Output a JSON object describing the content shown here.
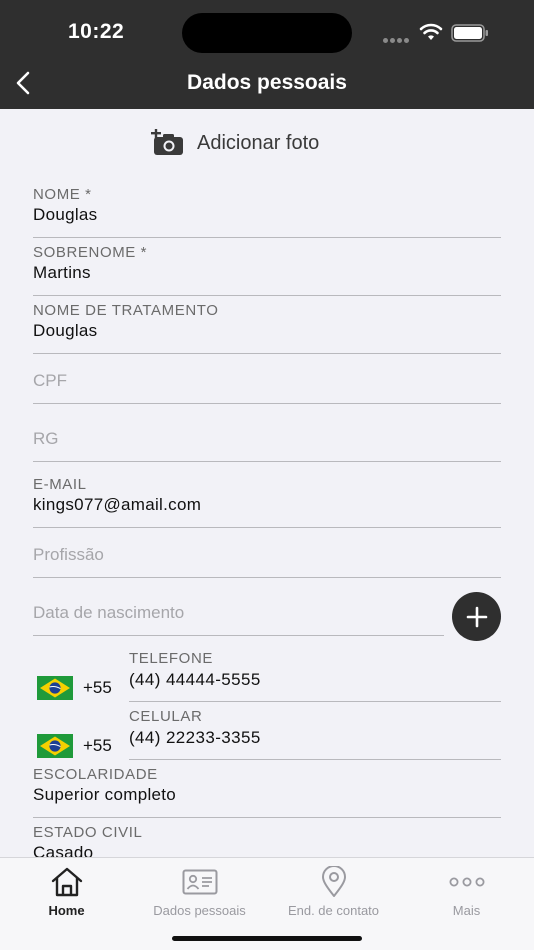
{
  "status": {
    "time": "10:22"
  },
  "header": {
    "title": "Dados pessoais"
  },
  "add_photo": {
    "label": "Adicionar foto"
  },
  "fields": {
    "nome": {
      "label": "NOME *",
      "value": "Douglas"
    },
    "sobrenome": {
      "label": "SOBRENOME *",
      "value": "Martins"
    },
    "tratamento": {
      "label": "NOME DE TRATAMENTO",
      "value": "Douglas"
    },
    "cpf": {
      "placeholder": "CPF"
    },
    "rg": {
      "placeholder": "RG"
    },
    "email": {
      "label": "E-MAIL",
      "value": "kings077@amail.com"
    },
    "profissao": {
      "placeholder": "Profissão"
    },
    "nascimento": {
      "placeholder": "Data de nascimento"
    },
    "escolaridade": {
      "label": "ESCOLARIDADE",
      "value": "Superior completo"
    },
    "estado_civil": {
      "label": "ESTADO CIVIL",
      "value": "Casado"
    }
  },
  "phones": {
    "telefone": {
      "label": "TELEFONE",
      "dial": "+55",
      "value": "(44) 44444-5555",
      "flag": "brazil-flag-icon"
    },
    "celular": {
      "label": "CELULAR",
      "dial": "+55",
      "value": "(44) 22233-3355",
      "flag": "brazil-flag-icon"
    }
  },
  "tabs": [
    {
      "label": "Home",
      "icon": "home-icon",
      "active": true
    },
    {
      "label": "Dados pessoais",
      "icon": "id-card-icon",
      "active": false
    },
    {
      "label": "End. de contato",
      "icon": "location-pin-icon",
      "active": false
    },
    {
      "label": "Mais",
      "icon": "more-dots-icon",
      "active": false
    }
  ],
  "colors": {
    "header_bg": "#2f2f2f",
    "page_bg": "#f2f2f7",
    "label": "#6b6b6b",
    "placeholder": "#a6a6aa",
    "divider": "#b9b9bd",
    "tab_inactive": "#9a9aa0"
  }
}
